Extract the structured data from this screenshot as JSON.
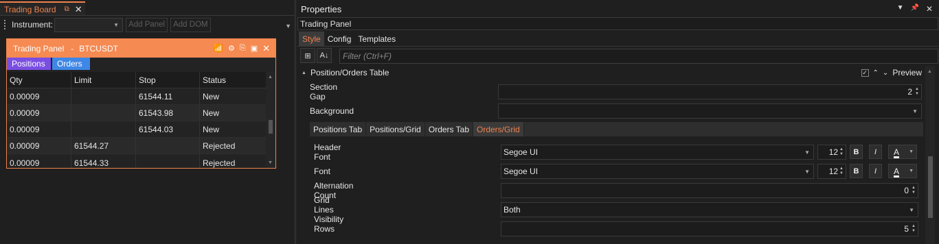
{
  "trading_board": {
    "tab_title": "Trading Board",
    "instrument_label": "Instrument:",
    "add_panel_label": "Add Panel",
    "add_dom_label": "Add DOM"
  },
  "trading_panel": {
    "title": "Trading Panel",
    "separator": "-",
    "symbol": "BTCUSDT",
    "tabs": [
      "Positions",
      "Orders"
    ],
    "columns": [
      "Qty",
      "Limit",
      "Stop",
      "Status"
    ],
    "rows": [
      {
        "qty": "0.00009",
        "limit": "",
        "stop": "61544.11",
        "status": "New"
      },
      {
        "qty": "0.00009",
        "limit": "",
        "stop": "61543.98",
        "status": "New"
      },
      {
        "qty": "0.00009",
        "limit": "",
        "stop": "61544.03",
        "status": "New"
      },
      {
        "qty": "0.00009",
        "limit": "61544.27",
        "stop": "",
        "status": "Rejected"
      },
      {
        "qty": "0.00009",
        "limit": "61544.33",
        "stop": "",
        "status": "Rejected"
      }
    ]
  },
  "properties": {
    "title": "Properties",
    "object_name": "Trading Panel",
    "tabs": [
      "Style",
      "Config",
      "Templates"
    ],
    "filter_placeholder": "Filter (Ctrl+F)",
    "section_title": "Position/Orders Table",
    "preview_label": "Preview",
    "section_gap_label": "Section Gap",
    "section_gap_value": "2",
    "background_label": "Background",
    "sub_tabs": [
      "Positions Tab",
      "Positions/Grid",
      "Orders Tab",
      "Orders/Grid"
    ],
    "header_font_label": "Header Font",
    "header_font_value": "Segoe UI",
    "header_font_size": "12",
    "font_label": "Font",
    "font_value": "Segoe UI",
    "font_size": "12",
    "bold_label": "B",
    "italic_label": "I",
    "color_label": "A",
    "alternation_count_label": "Alternation Count",
    "alternation_count_value": "0",
    "grid_lines_label": "Grid Lines Visibility",
    "grid_lines_value": "Both",
    "rows_label": "Rows",
    "rows_value": "5"
  },
  "colors": {
    "accent": "#f0834d",
    "positions_tab": "#7a4ee3",
    "orders_tab": "#3f87e6"
  }
}
